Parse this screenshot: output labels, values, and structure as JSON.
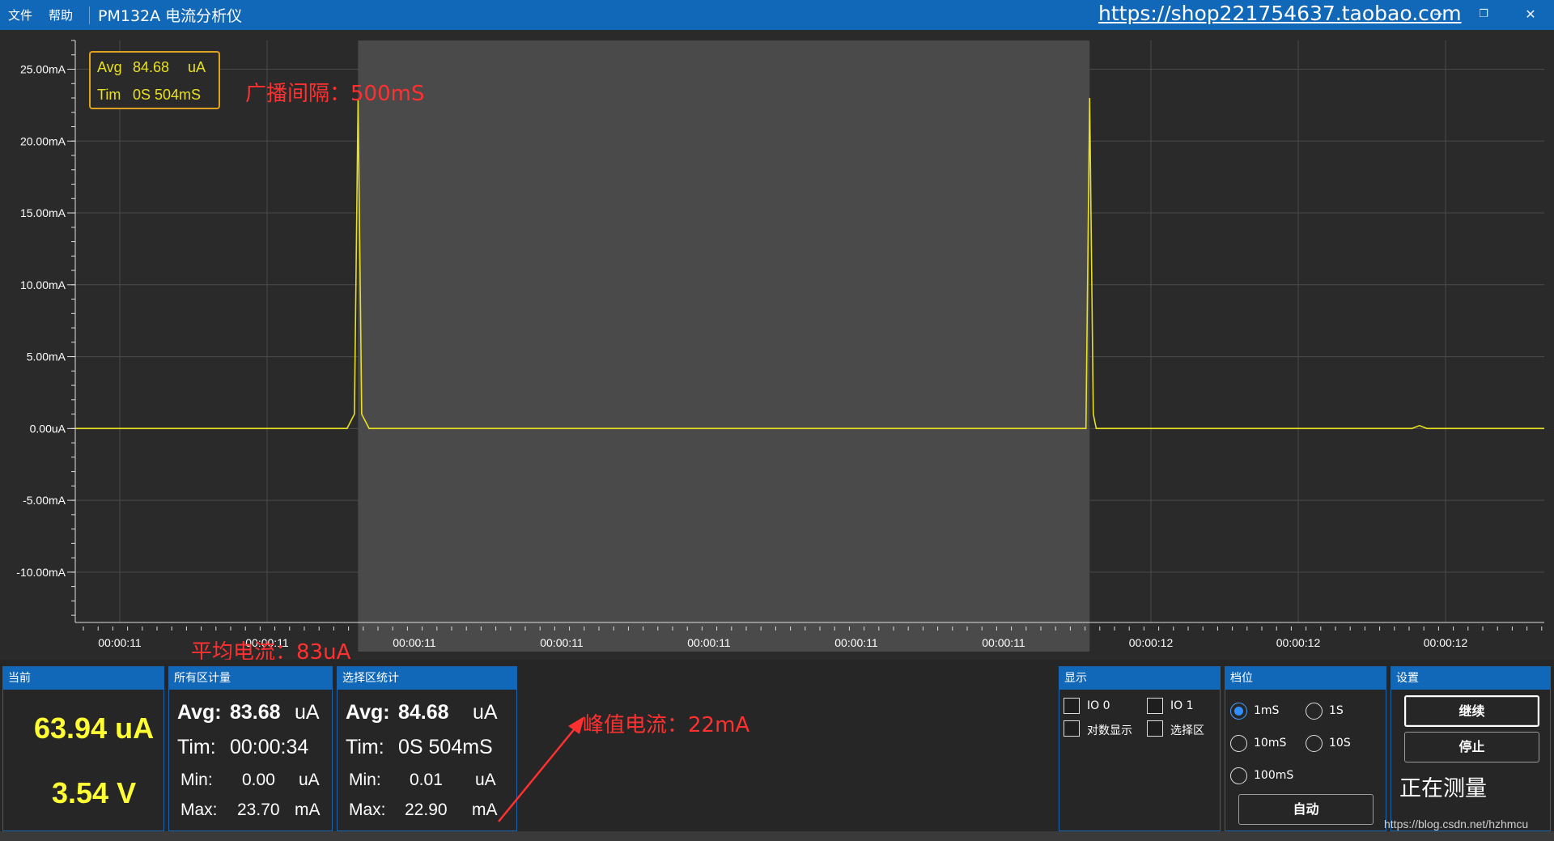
{
  "titlebar": {
    "menu": [
      "文件",
      "帮助"
    ],
    "app_title": "PM132A 电流分析仪",
    "shop_link": "https://shop221754637.taobao.com",
    "min_icon": "minimize-icon",
    "restore_icon": "restore-icon",
    "close_icon": "close-icon"
  },
  "chart_data": {
    "type": "line",
    "title": "",
    "xlabel": "",
    "ylabel": "",
    "ylim_mA": [
      -13.5,
      27
    ],
    "y_ticks_mA": [
      25,
      20,
      15,
      10,
      5,
      0,
      -5,
      -10
    ],
    "y_tick_labels": [
      "25.00mA",
      "20.00mA",
      "15.00mA",
      "10.00mA",
      "5.00mA",
      "0.00uA",
      "-5.00mA",
      "-10.00mA"
    ],
    "x_tick_labels": [
      "00:00:11",
      "00:00:11",
      "00:00:11",
      "00:00:11",
      "00:00:11",
      "00:00:11",
      "00:00:11",
      "00:00:12",
      "00:00:12",
      "00:00:12"
    ],
    "grid": true,
    "series": [
      {
        "color": "#e8e020",
        "x_frac": [
          0,
          0.185,
          0.19,
          0.1925,
          0.195,
          0.2,
          0.688,
          0.6905,
          0.693,
          0.695,
          0.7,
          0.91,
          0.915,
          0.92,
          1.0
        ],
        "y_mA": [
          0.0,
          0.0,
          1.0,
          22.9,
          1.0,
          0.0,
          0.0,
          23.0,
          1.0,
          0.0,
          0.0,
          0.0,
          0.2,
          0.0,
          0.0
        ]
      }
    ],
    "selection": {
      "start_frac": 0.1925,
      "end_frac": 0.6905
    },
    "overlay": {
      "avg_label": "Avg",
      "avg_value": "84.68",
      "avg_unit": "uA",
      "tim_label": "Tim",
      "tim_value": "0S 504mS"
    },
    "colors": {
      "background": "#2a2a2a",
      "selection": "#4a4a4a",
      "grid": "#4a4a4a",
      "trace": "#e8e020",
      "overlay_border": "#e0a020"
    }
  },
  "annotations": {
    "interval": "广播间隔：500mS",
    "avg_current": "平均电流：83uA",
    "peak_current": "峰值电流：22mA"
  },
  "panels": {
    "current": {
      "title": "当前",
      "current": "63.94 uA",
      "voltage": "3.54 V"
    },
    "all": {
      "title": "所有区计量",
      "avg_label": "Avg:",
      "avg_value": "83.68",
      "avg_unit": "uA",
      "tim_label": "Tim:",
      "tim_value": "00:00:34",
      "min_label": "Min:",
      "min_value": "0.00",
      "min_unit": "uA",
      "max_label": "Max:",
      "max_value": "23.70",
      "max_unit": "mA"
    },
    "selection": {
      "title": "选择区统计",
      "avg_label": "Avg:",
      "avg_value": "84.68",
      "avg_unit": "uA",
      "tim_label": "Tim:",
      "tim_value": "0S 504mS",
      "min_label": "Min:",
      "min_value": "0.01",
      "min_unit": "uA",
      "max_label": "Max:",
      "max_value": "22.90",
      "max_unit": "mA"
    },
    "display": {
      "title": "显示",
      "io0": "IO 0",
      "io1": "IO 1",
      "log": "对数显示",
      "select_area": "选择区"
    },
    "range": {
      "title": "档位",
      "opt_1ms": "1mS",
      "opt_1s": "1S",
      "opt_10ms": "10mS",
      "opt_10s": "10S",
      "opt_100ms": "100mS",
      "auto": "自动",
      "selected": "1mS"
    },
    "settings": {
      "title": "设置",
      "continue": "继续",
      "stop": "停止",
      "status": "正在测量"
    }
  },
  "watermark": "https://blog.csdn.net/hzhmcu"
}
